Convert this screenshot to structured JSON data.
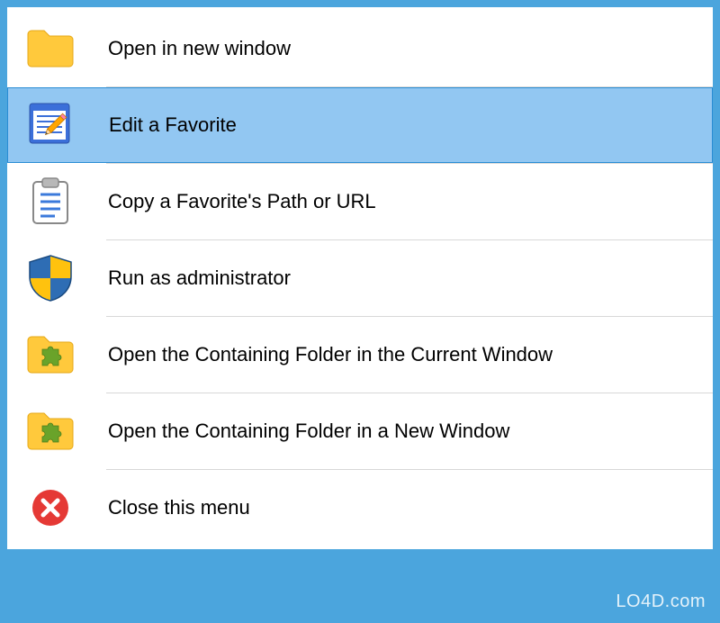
{
  "menu": {
    "items": [
      {
        "icon": "folder-icon",
        "label": "Open in new window",
        "highlighted": false
      },
      {
        "icon": "edit-note-icon",
        "label": "Edit a Favorite",
        "highlighted": true
      },
      {
        "icon": "clipboard-icon",
        "label": "Copy a Favorite's Path or URL",
        "highlighted": false
      },
      {
        "icon": "shield-icon",
        "label": "Run as administrator",
        "highlighted": false
      },
      {
        "icon": "folder-puzzle-icon",
        "label": "Open the Containing Folder in the Current Window",
        "highlighted": false
      },
      {
        "icon": "folder-puzzle-icon",
        "label": "Open the Containing Folder in a New Window",
        "highlighted": false
      },
      {
        "icon": "close-circle-icon",
        "label": "Close this menu",
        "highlighted": false
      }
    ]
  },
  "watermark": "LO4D.com"
}
